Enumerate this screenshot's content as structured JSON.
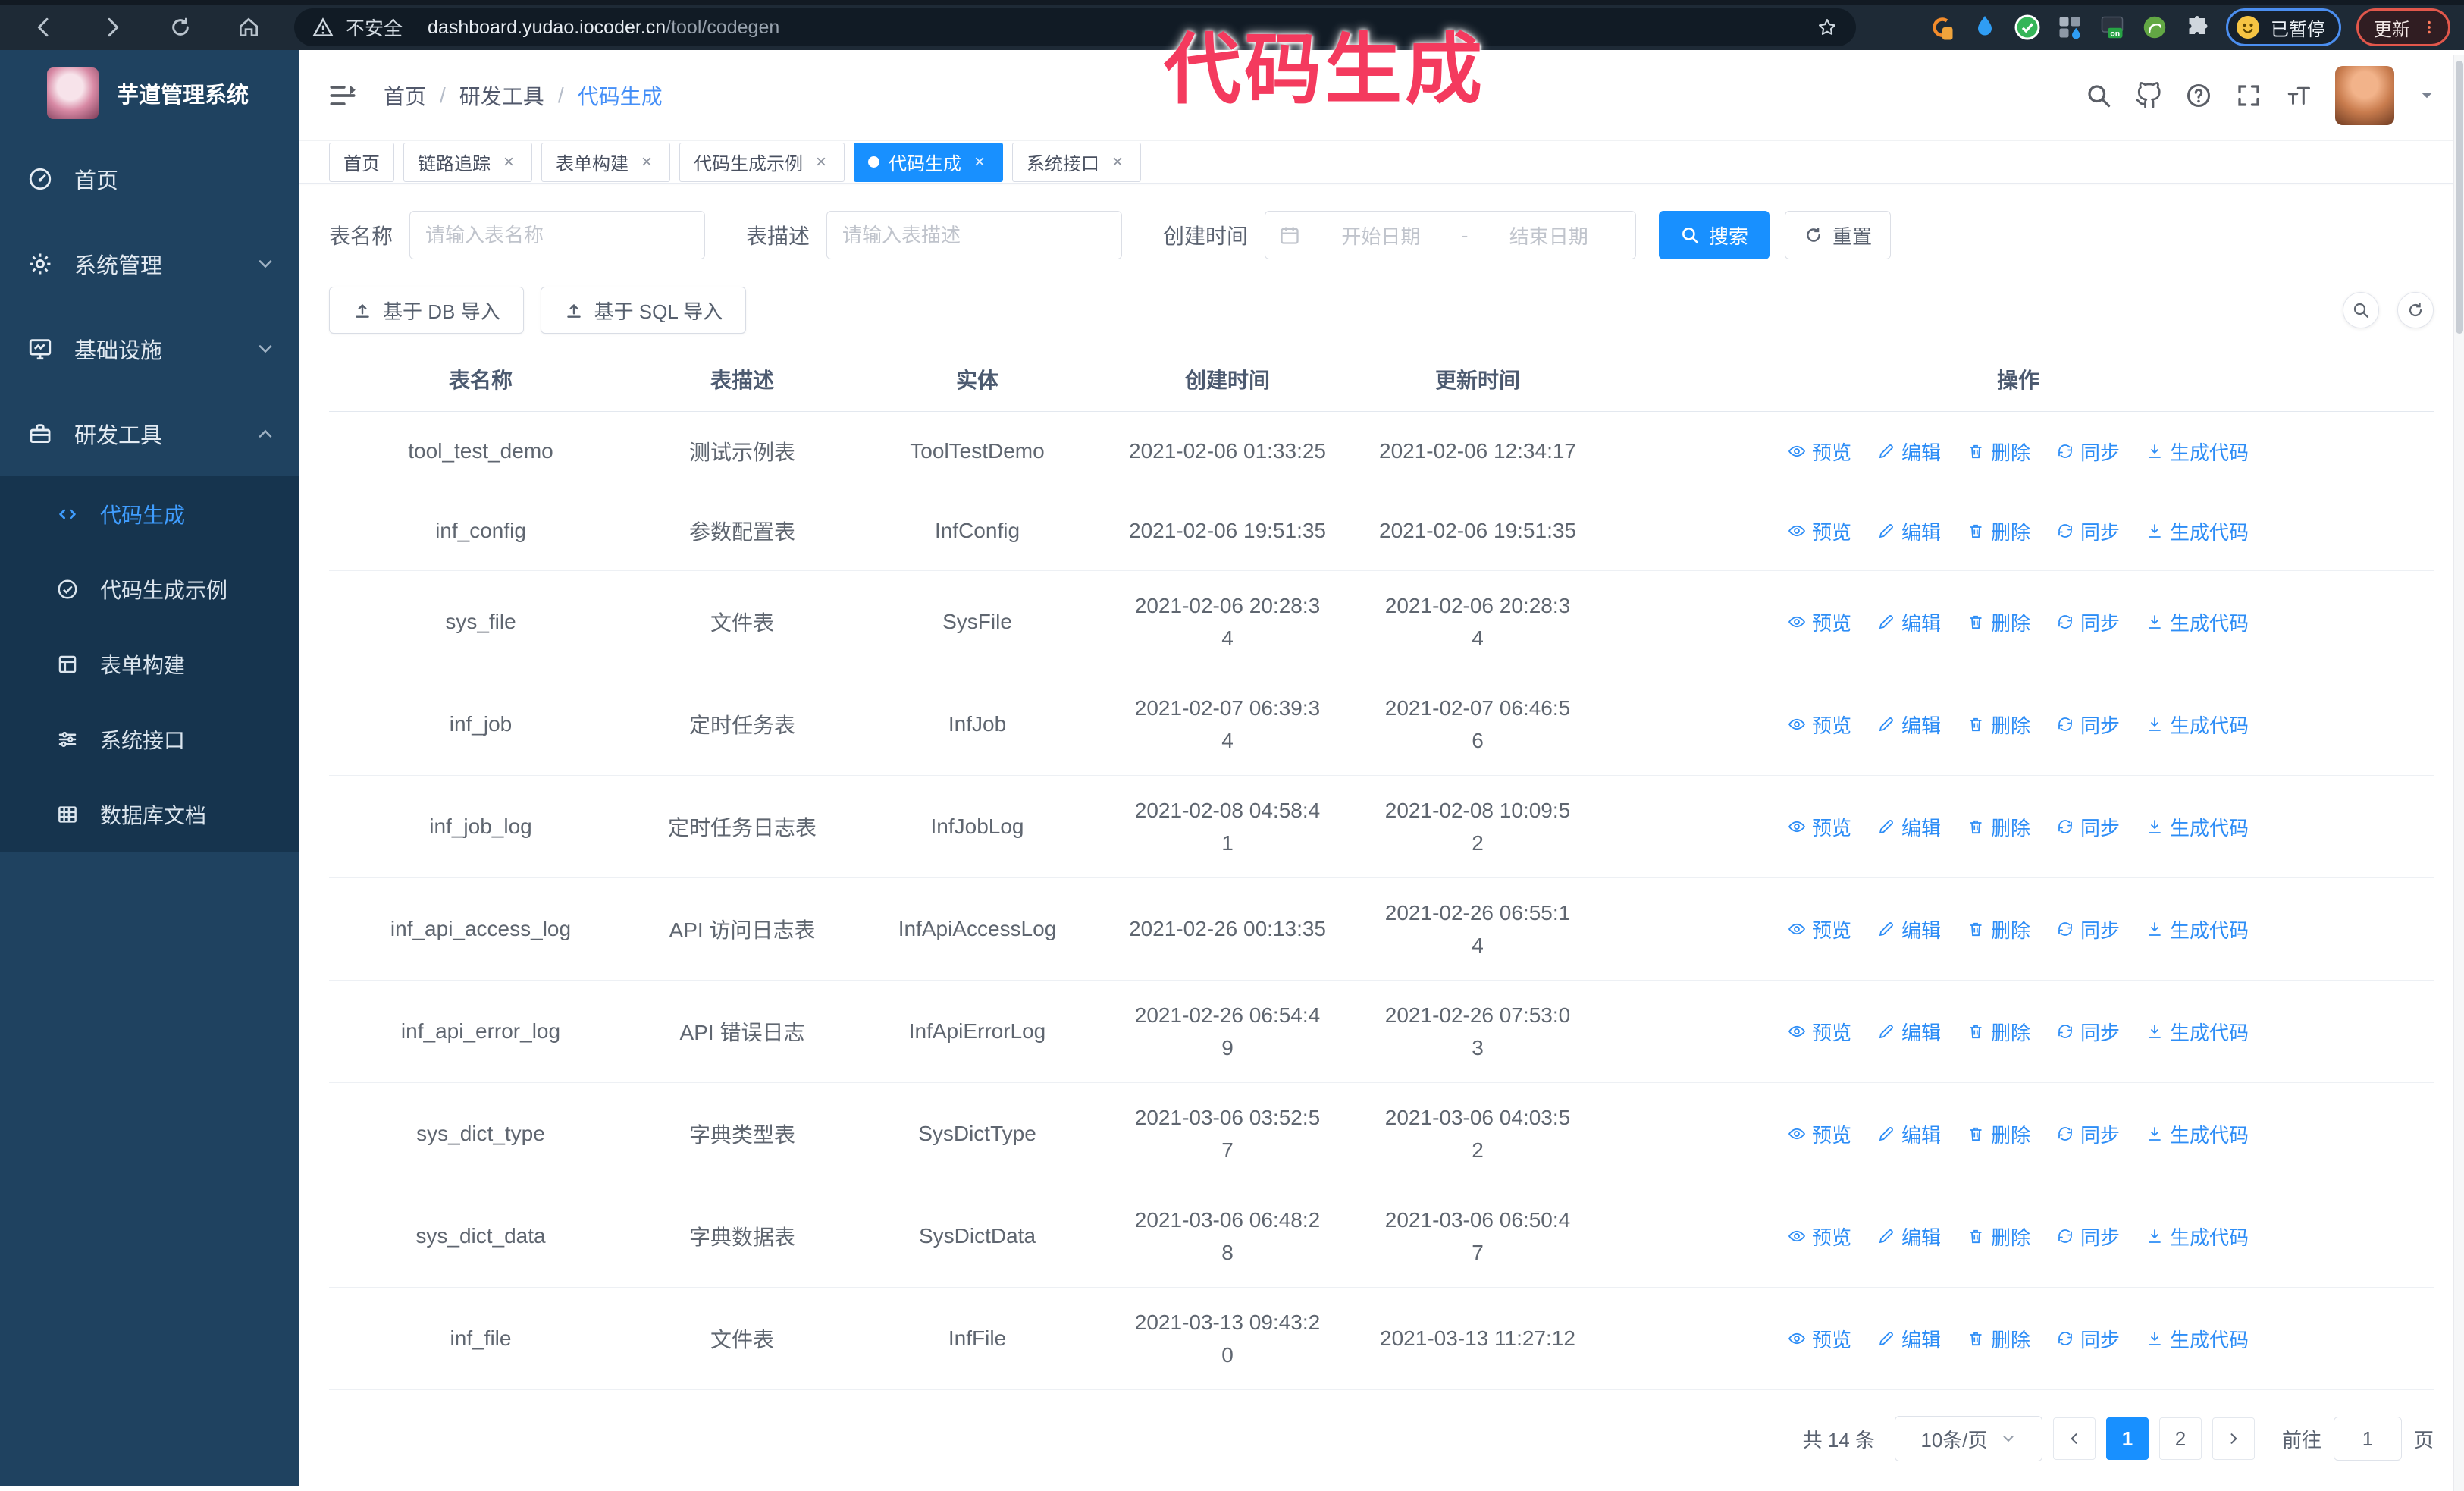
{
  "browser": {
    "security_label": "不安全",
    "url_host": "dashboard.yudao.iocoder.cn",
    "url_path": "/tool/codegen",
    "extension_badge": "on",
    "profile_status": "已暂停",
    "update_label": "更新"
  },
  "annotation": {
    "text": "代码生成"
  },
  "theme": {
    "primary": "#1890ff",
    "annotation_color": "#f43a5e",
    "sidebar_bg": "#1f4260",
    "sidebar_submenu_bg": "#16344e",
    "sidebar_active_text": "#3f9dff",
    "link_color": "#2d8df6"
  },
  "sidebar": {
    "title": "芋道管理系统",
    "menu": [
      {
        "id": "home",
        "icon": "dashboard-icon",
        "label": "首页"
      },
      {
        "id": "system",
        "icon": "gear-icon",
        "label": "系统管理",
        "arrow": "down"
      },
      {
        "id": "infra",
        "icon": "monitor-icon",
        "label": "基础设施",
        "arrow": "down"
      },
      {
        "id": "devtools",
        "icon": "toolbox-icon",
        "label": "研发工具",
        "arrow": "up",
        "children": [
          {
            "id": "codegen",
            "icon": "code-icon",
            "label": "代码生成",
            "active": true
          },
          {
            "id": "codegen-example",
            "icon": "badge-icon",
            "label": "代码生成示例"
          },
          {
            "id": "form-builder",
            "icon": "form-icon",
            "label": "表单构建"
          },
          {
            "id": "system-api",
            "icon": "sliders-icon",
            "label": "系统接口"
          },
          {
            "id": "db-doc",
            "icon": "table-icon",
            "label": "数据库文档"
          }
        ]
      }
    ]
  },
  "header": {
    "breadcrumb": [
      "首页",
      "研发工具",
      "代码生成"
    ],
    "breadcrumb_separator": "/"
  },
  "tabs": [
    {
      "id": "home",
      "label": "首页",
      "closable": false,
      "active": false
    },
    {
      "id": "trace",
      "label": "链路追踪",
      "closable": true,
      "active": false
    },
    {
      "id": "form-builder",
      "label": "表单构建",
      "closable": true,
      "active": false
    },
    {
      "id": "codegen-example",
      "label": "代码生成示例",
      "closable": true,
      "active": false
    },
    {
      "id": "codegen",
      "label": "代码生成",
      "closable": true,
      "active": true
    },
    {
      "id": "system-api",
      "label": "系统接口",
      "closable": true,
      "active": false
    }
  ],
  "filters": {
    "name_label": "表名称",
    "name_placeholder": "请输入表名称",
    "desc_label": "表描述",
    "desc_placeholder": "请输入表描述",
    "time_label": "创建时间",
    "start_placeholder": "开始日期",
    "range_separator": "-",
    "end_placeholder": "结束日期",
    "search_label": "搜索",
    "reset_label": "重置"
  },
  "toolbar": {
    "import_db_label": "基于 DB 导入",
    "import_sql_label": "基于 SQL 导入"
  },
  "table": {
    "columns": [
      "表名称",
      "表描述",
      "实体",
      "创建时间",
      "更新时间",
      "操作"
    ],
    "action_labels": [
      "预览",
      "编辑",
      "删除",
      "同步",
      "生成代码"
    ],
    "rows": [
      {
        "name": "tool_test_demo",
        "desc": "测试示例表",
        "entity": "ToolTestDemo",
        "created": "2021-02-06 01:33:25",
        "updated": "2021-02-06 12:34:17"
      },
      {
        "name": "inf_config",
        "desc": "参数配置表",
        "entity": "InfConfig",
        "created": "2021-02-06 19:51:35",
        "updated": "2021-02-06 19:51:35"
      },
      {
        "name": "sys_file",
        "desc": "文件表",
        "entity": "SysFile",
        "created": "2021-02-06 20:28:3\n4",
        "updated": "2021-02-06 20:28:3\n4"
      },
      {
        "name": "inf_job",
        "desc": "定时任务表",
        "entity": "InfJob",
        "created": "2021-02-07 06:39:3\n4",
        "updated": "2021-02-07 06:46:5\n6"
      },
      {
        "name": "inf_job_log",
        "desc": "定时任务日志表",
        "entity": "InfJobLog",
        "created": "2021-02-08 04:58:4\n1",
        "updated": "2021-02-08 10:09:5\n2"
      },
      {
        "name": "inf_api_access_log",
        "desc": "API 访问日志表",
        "entity": "InfApiAccessLog",
        "created": "2021-02-26 00:13:35",
        "updated": "2021-02-26 06:55:1\n4"
      },
      {
        "name": "inf_api_error_log",
        "desc": "API 错误日志",
        "entity": "InfApiErrorLog",
        "created": "2021-02-26 06:54:4\n9",
        "updated": "2021-02-26 07:53:0\n3"
      },
      {
        "name": "sys_dict_type",
        "desc": "字典类型表",
        "entity": "SysDictType",
        "created": "2021-03-06 03:52:5\n7",
        "updated": "2021-03-06 04:03:5\n2"
      },
      {
        "name": "sys_dict_data",
        "desc": "字典数据表",
        "entity": "SysDictData",
        "created": "2021-03-06 06:48:2\n8",
        "updated": "2021-03-06 06:50:4\n7"
      },
      {
        "name": "inf_file",
        "desc": "文件表",
        "entity": "InfFile",
        "created": "2021-03-13 09:43:2\n0",
        "updated": "2021-03-13 11:27:12"
      }
    ]
  },
  "pagination": {
    "total": "共 14 条",
    "per_page": "10条/页",
    "pages": [
      {
        "label": "1",
        "active": true
      },
      {
        "label": "2",
        "active": false
      }
    ],
    "goto_label": "前往",
    "goto_value": "1",
    "page_suffix": "页"
  }
}
